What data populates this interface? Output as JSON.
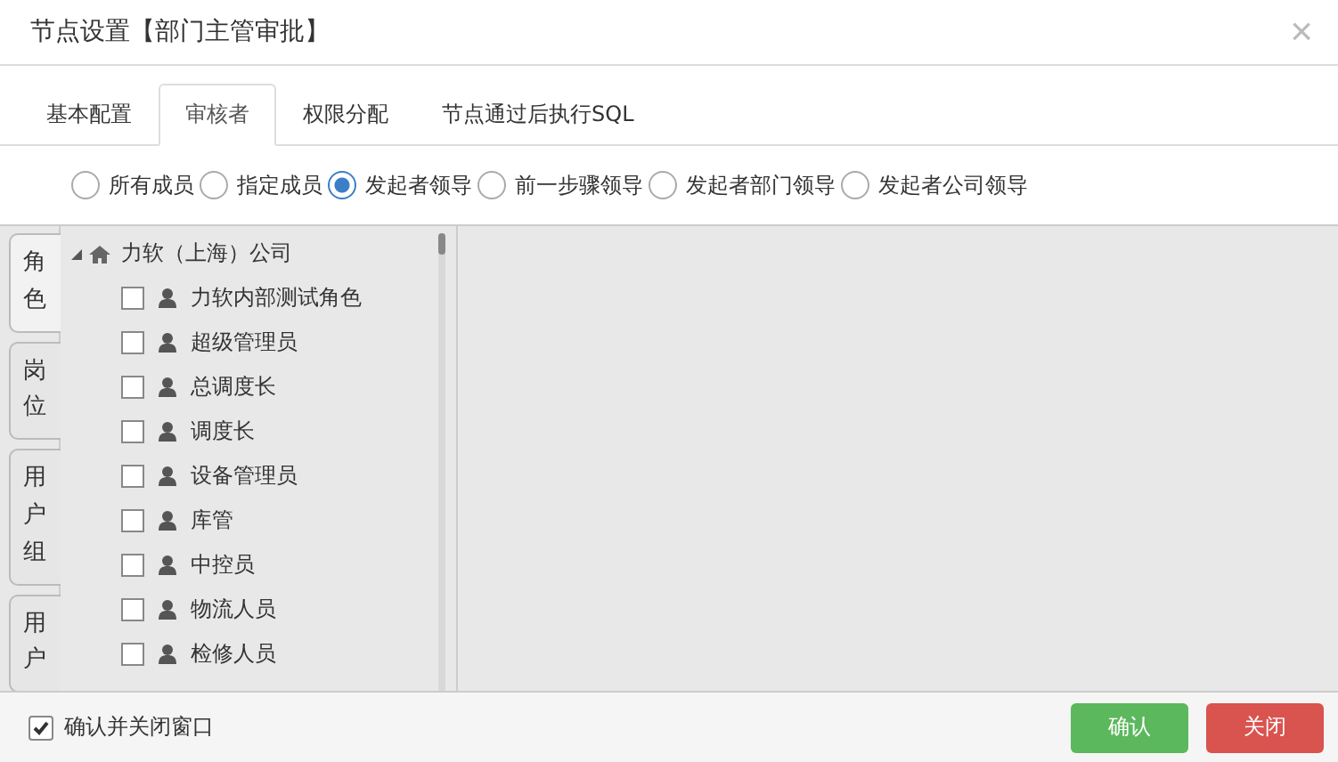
{
  "window": {
    "title": "节点设置【部门主管审批】",
    "close": "×"
  },
  "tabs": [
    {
      "label": "基本配置",
      "selected": false
    },
    {
      "label": "审核者",
      "selected": true
    },
    {
      "label": "权限分配",
      "selected": false
    },
    {
      "label": "节点通过后执行SQL",
      "selected": false
    }
  ],
  "approver_options": [
    {
      "label": "所有成员",
      "selected": false
    },
    {
      "label": "指定成员",
      "selected": false
    },
    {
      "label": "发起者领导",
      "selected": true
    },
    {
      "label": "前一步骤领导",
      "selected": false
    },
    {
      "label": "发起者部门领导",
      "selected": false
    },
    {
      "label": "发起者公司领导",
      "selected": false
    }
  ],
  "side_tabs": [
    {
      "label": "角色",
      "selected": true
    },
    {
      "label": "岗位",
      "selected": false
    },
    {
      "label": "用户组",
      "selected": false
    },
    {
      "label": "用户",
      "selected": false
    }
  ],
  "tree": {
    "label": "力软（上海）公司",
    "expanded": true,
    "children": [
      {
        "label": "力软内部测试角色",
        "checked": false
      },
      {
        "label": "超级管理员",
        "checked": false
      },
      {
        "label": "总调度长",
        "checked": false
      },
      {
        "label": "调度长",
        "checked": false
      },
      {
        "label": "设备管理员",
        "checked": false
      },
      {
        "label": "库管",
        "checked": false
      },
      {
        "label": "中控员",
        "checked": false
      },
      {
        "label": "物流人员",
        "checked": false
      },
      {
        "label": "检修人员",
        "checked": false
      }
    ]
  },
  "footer": {
    "close_on_confirm": {
      "label": "确认并关闭窗口",
      "checked": true
    },
    "buttons": [
      {
        "label": "确认",
        "kind": "confirm"
      },
      {
        "label": "关闭",
        "kind": "close"
      }
    ]
  }
}
